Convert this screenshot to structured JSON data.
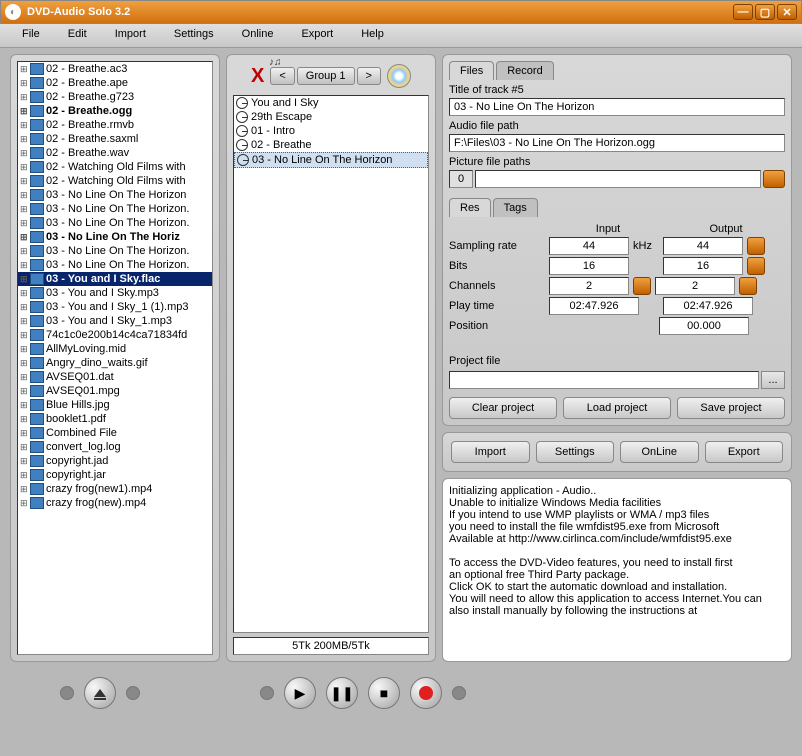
{
  "app": {
    "title": "DVD-Audio Solo 3.2"
  },
  "menus": [
    "File",
    "Edit",
    "Import",
    "Settings",
    "Online",
    "Export",
    "Help"
  ],
  "files": [
    {
      "name": "02 - Breathe.ac3",
      "bold": false,
      "sel": false
    },
    {
      "name": "02 - Breathe.ape",
      "bold": false,
      "sel": false
    },
    {
      "name": "02 - Breathe.g723",
      "bold": false,
      "sel": false
    },
    {
      "name": "02 - Breathe.ogg",
      "bold": true,
      "sel": false
    },
    {
      "name": "02 - Breathe.rmvb",
      "bold": false,
      "sel": false
    },
    {
      "name": "02 - Breathe.saxml",
      "bold": false,
      "sel": false
    },
    {
      "name": "02 - Breathe.wav",
      "bold": false,
      "sel": false
    },
    {
      "name": "02 - Watching Old Films with",
      "bold": false,
      "sel": false
    },
    {
      "name": "02 - Watching Old Films with",
      "bold": false,
      "sel": false
    },
    {
      "name": "03 - No Line On The Horizon",
      "bold": false,
      "sel": false
    },
    {
      "name": "03 - No Line On The Horizon.",
      "bold": false,
      "sel": false
    },
    {
      "name": "03 - No Line On The Horizon.",
      "bold": false,
      "sel": false
    },
    {
      "name": "03 - No Line On The Horiz",
      "bold": true,
      "sel": false
    },
    {
      "name": "03 - No Line On The Horizon.",
      "bold": false,
      "sel": false
    },
    {
      "name": "03 - No Line On The Horizon.",
      "bold": false,
      "sel": false
    },
    {
      "name": "03 - You and I Sky.flac",
      "bold": true,
      "sel": true
    },
    {
      "name": "03 - You and I Sky.mp3",
      "bold": false,
      "sel": false
    },
    {
      "name": "03 - You and I Sky_1 (1).mp3",
      "bold": false,
      "sel": false
    },
    {
      "name": "03 - You and I Sky_1.mp3",
      "bold": false,
      "sel": false
    },
    {
      "name": "74c1c0e200b14c4ca71834fd",
      "bold": false,
      "sel": false
    },
    {
      "name": "AllMyLoving.mid",
      "bold": false,
      "sel": false
    },
    {
      "name": "Angry_dino_waits.gif",
      "bold": false,
      "sel": false
    },
    {
      "name": "AVSEQ01.dat",
      "bold": false,
      "sel": false
    },
    {
      "name": "AVSEQ01.mpg",
      "bold": false,
      "sel": false
    },
    {
      "name": "Blue Hills.jpg",
      "bold": false,
      "sel": false
    },
    {
      "name": "booklet1.pdf",
      "bold": false,
      "sel": false
    },
    {
      "name": "Combined File",
      "bold": false,
      "sel": false
    },
    {
      "name": "convert_log.log",
      "bold": false,
      "sel": false
    },
    {
      "name": "copyright.jad",
      "bold": false,
      "sel": false
    },
    {
      "name": "copyright.jar",
      "bold": false,
      "sel": false
    },
    {
      "name": "crazy frog(new1).mp4",
      "bold": false,
      "sel": false
    },
    {
      "name": "crazy frog(new).mp4",
      "bold": false,
      "sel": false
    }
  ],
  "group": {
    "prev": "<",
    "label": "Group 1",
    "next": ">"
  },
  "tracks": [
    {
      "name": "You and I Sky",
      "sel": false
    },
    {
      "name": "29th Escape",
      "sel": false
    },
    {
      "name": "01 - Intro",
      "sel": false
    },
    {
      "name": "02 - Breathe",
      "sel": false
    },
    {
      "name": "03 - No Line On The Horizon",
      "sel": true
    }
  ],
  "disc_status": "5Tk 200MB/5Tk",
  "tabs": {
    "files": "Files",
    "record": "Record"
  },
  "props": {
    "title_label": "Title of track #5",
    "title_value": "03 - No Line On The Horizon",
    "path_label": "Audio file path",
    "path_value": "F:\\Files\\03 - No Line On The Horizon.ogg",
    "pic_label": "Picture file paths",
    "pic_index": "0",
    "inner_tabs": {
      "res": "Res",
      "tags": "Tags"
    },
    "input_hdr": "Input",
    "output_hdr": "Output",
    "rows": {
      "sampling": {
        "label": "Sampling rate",
        "in": "44",
        "unit": "kHz",
        "out": "44"
      },
      "bits": {
        "label": "Bits",
        "in": "16",
        "out": "16"
      },
      "channels": {
        "label": "Channels",
        "in": "2",
        "out": "2"
      },
      "playtime": {
        "label": "Play time",
        "in": "02:47.926",
        "out": "02:47.926"
      },
      "position": {
        "label": "Position",
        "out": "00.000"
      }
    },
    "project_label": "Project file",
    "buttons": {
      "clear": "Clear project",
      "load": "Load project",
      "save": "Save project"
    }
  },
  "bottom_buttons": {
    "import": "Import",
    "settings": "Settings",
    "online": "OnLine",
    "export": "Export"
  },
  "log": "Initializing application - Audio..\nUnable to initialize Windows Media facilities\nIf you intend to use WMP playlists or WMA / mp3 files\nyou need to install the file wmfdist95.exe from Microsoft\nAvailable at http://www.cirlinca.com/include/wmfdist95.exe\n\nTo access the DVD-Video features, you need to install first\nan optional free Third Party package.\nClick OK to start the automatic download and installation.\nYou will need to allow this application to access Internet.You can also install manually by following the instructions at"
}
